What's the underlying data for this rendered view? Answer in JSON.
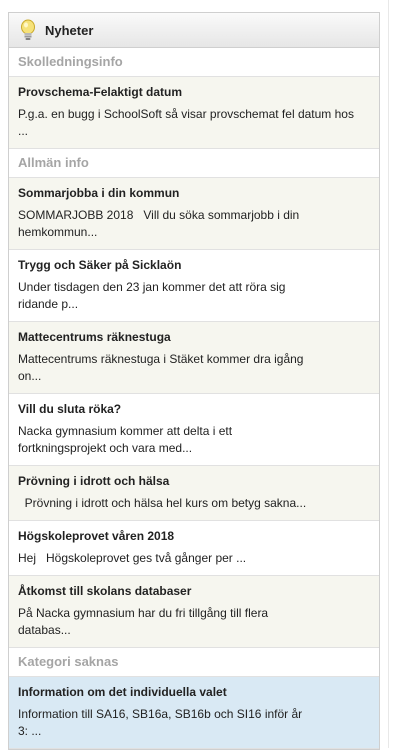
{
  "widget": {
    "title": "Nyheter",
    "icon": "lightbulb-icon"
  },
  "sections": [
    {
      "heading": "Skolledningsinfo",
      "items": [
        {
          "title": "Provschema-Felaktigt datum",
          "excerpt": "P.g.a. en bugg i SchoolSoft så visar provschemat fel datum hos ..."
        }
      ]
    },
    {
      "heading": "Allmän info",
      "items": [
        {
          "title": "Sommarjobba i din kommun",
          "excerpt": "SOMMARJOBB 2018   Vill du söka sommarjobb i din hemkommun..."
        },
        {
          "title": "Trygg och Säker på Sicklaön",
          "excerpt": "Under tisdagen den 23 jan kommer det att röra sig ridande p..."
        },
        {
          "title": "Mattecentrums räknestuga",
          "excerpt": "Mattecentrums räknestuga i Stäket kommer dra igång on..."
        },
        {
          "title": "Vill du sluta röka?",
          "excerpt": "Nacka gymnasium kommer att delta i ett fortkningsprojekt och vara med..."
        },
        {
          "title": "Prövning i idrott och hälsa",
          "excerpt": "  Prövning i idrott och hälsa hel kurs om betyg sakna..."
        },
        {
          "title": "Högskoleprovet våren 2018",
          "excerpt": "Hej   Högskoleprovet ges två gånger per ..."
        },
        {
          "title": "Åtkomst till skolans databaser",
          "excerpt": "På Nacka gymnasium har du fri tillgång till flera databas..."
        }
      ]
    },
    {
      "heading": "Kategori saknas",
      "items": [
        {
          "title": "Information om det individuella valet",
          "excerpt": "Information till SA16, SB16a, SB16b och SI16 inför år 3: ..."
        }
      ]
    }
  ],
  "colors": {
    "item_shaded": "#f6f6ef",
    "item_white": "#ffffff",
    "item_highlight": "#d9e9f4",
    "category_text": "#a5a5a5"
  }
}
